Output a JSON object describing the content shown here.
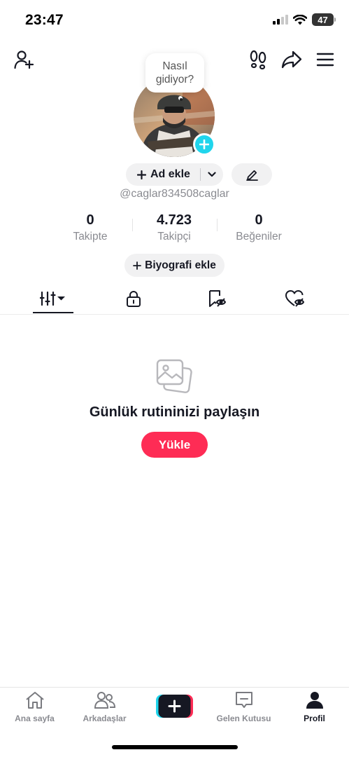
{
  "status": {
    "time": "23:47",
    "battery": "47"
  },
  "profile": {
    "bubble_text": "Nasıl gidiyor?",
    "add_name_label": "Ad ekle",
    "username": "@caglar834508caglar",
    "bio_label": "Biyografi ekle"
  },
  "stats": [
    {
      "value": "0",
      "label": "Takipte"
    },
    {
      "value": "4.723",
      "label": "Takipçi"
    },
    {
      "value": "0",
      "label": "Beğeniler"
    }
  ],
  "tabs": [
    {
      "icon": "grid-videos-icon",
      "active": true
    },
    {
      "icon": "lock-icon",
      "active": false
    },
    {
      "icon": "bookmark-icon",
      "active": false
    },
    {
      "icon": "liked-heart-icon",
      "active": false
    }
  ],
  "empty_state": {
    "title": "Günlük rutininizi paylaşın",
    "button": "Yükle"
  },
  "bottom_nav": [
    {
      "label": "Ana sayfa",
      "icon": "home-icon"
    },
    {
      "label": "Arkadaşlar",
      "icon": "friends-icon"
    },
    {
      "label": "",
      "icon": "create-plus-icon"
    },
    {
      "label": "Gelen Kutusu",
      "icon": "inbox-icon"
    },
    {
      "label": "Profil",
      "icon": "profile-icon",
      "active": true
    }
  ],
  "colors": {
    "accent_red": "#fe2c55",
    "accent_cyan": "#20d5ec",
    "text_dark": "#161823",
    "text_gray": "#8a8b91"
  }
}
